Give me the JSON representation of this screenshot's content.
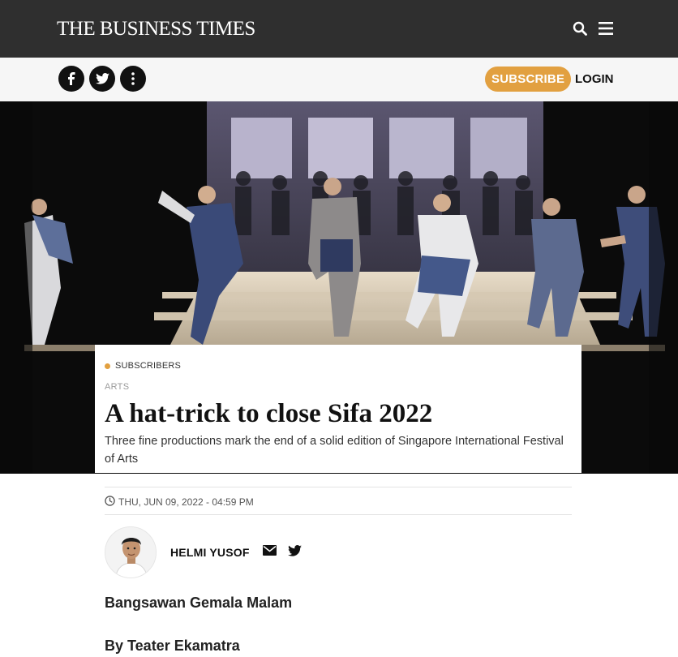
{
  "header": {
    "brand": "The Business Times",
    "icons": [
      "search-icon",
      "menu-icon"
    ],
    "colors": {
      "bar": "#2f2f2f",
      "text": "#ffffff"
    }
  },
  "sharebar": {
    "social_icons": [
      "facebook-icon",
      "twitter-icon",
      "more-icon"
    ],
    "subscribe_label": "SUBSCRIBE",
    "login_label": "LOGIN",
    "colors": {
      "subscribe": "#e2a040"
    }
  },
  "article": {
    "badge": "SUBSCRIBERS",
    "category": "ARTS",
    "headline": "A hat-trick to close Sifa 2022",
    "standfirst": "Three fine productions mark the end of a solid edition of Singapore International Festival of Arts",
    "datetime": "THU, JUN 09, 2022 - 04:59 PM",
    "author": "HELMI YUSOF",
    "author_icons": [
      "email-icon",
      "twitter-icon"
    ],
    "subheadings": [
      "Bangsawan Gemala Malam",
      "By Teater Ekamatra"
    ]
  }
}
